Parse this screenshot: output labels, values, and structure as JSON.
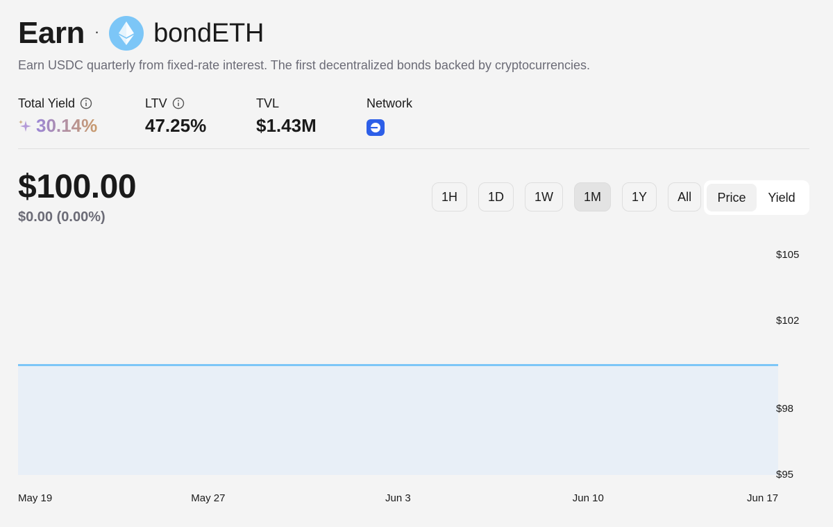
{
  "header": {
    "title": "Earn",
    "separator": "·",
    "token": "bondETH",
    "subtitle": "Earn USDC quarterly from fixed-rate interest. The first decentralized bonds backed by cryptocurrencies."
  },
  "stats": {
    "total_yield_label": "Total Yield",
    "total_yield_value": "30.14%",
    "ltv_label": "LTV",
    "ltv_value": "47.25%",
    "tvl_label": "TVL",
    "tvl_value": "$1.43M",
    "network_label": "Network"
  },
  "price": {
    "value": "$100.00",
    "change": "$0.00 (0.00%)"
  },
  "ranges": [
    "1H",
    "1D",
    "1W",
    "1M",
    "1Y",
    "All"
  ],
  "active_range": "1M",
  "toggle": {
    "options": [
      "Price",
      "Yield"
    ],
    "active": "Price"
  },
  "colors": {
    "line": "#7cc6f7",
    "area": "#e8eff7",
    "network": "#2d5fe8",
    "eth_logo": "#7cc6f7"
  },
  "chart_data": {
    "type": "area",
    "x": [
      "May 19",
      "May 27",
      "Jun 3",
      "Jun 10",
      "Jun 17"
    ],
    "series": [
      {
        "values": [
          100,
          100,
          100,
          100,
          100
        ]
      }
    ],
    "yticks": [
      "$105",
      "$102",
      "$98",
      "$95"
    ],
    "ytick_values": [
      105,
      102,
      98,
      95
    ],
    "ylim": [
      95,
      105
    ],
    "grid": false
  }
}
